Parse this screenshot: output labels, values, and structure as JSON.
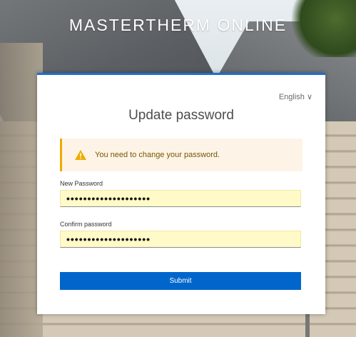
{
  "brand": {
    "name": "MASTERTHERM ONLINE"
  },
  "language": {
    "selected": "English ∨"
  },
  "page": {
    "title": "Update password"
  },
  "alert": {
    "message": "You need to change your password.",
    "icon": "warning-icon",
    "color": "#f0ab00"
  },
  "form": {
    "new_password": {
      "label": "New Password",
      "value": "••••••••••••••••••••"
    },
    "confirm_password": {
      "label": "Confirm password",
      "value": "••••••••••••••••••••"
    },
    "submit_label": "Submit"
  },
  "colors": {
    "accent": "#0066cc",
    "field_autofill": "#fffac8"
  }
}
